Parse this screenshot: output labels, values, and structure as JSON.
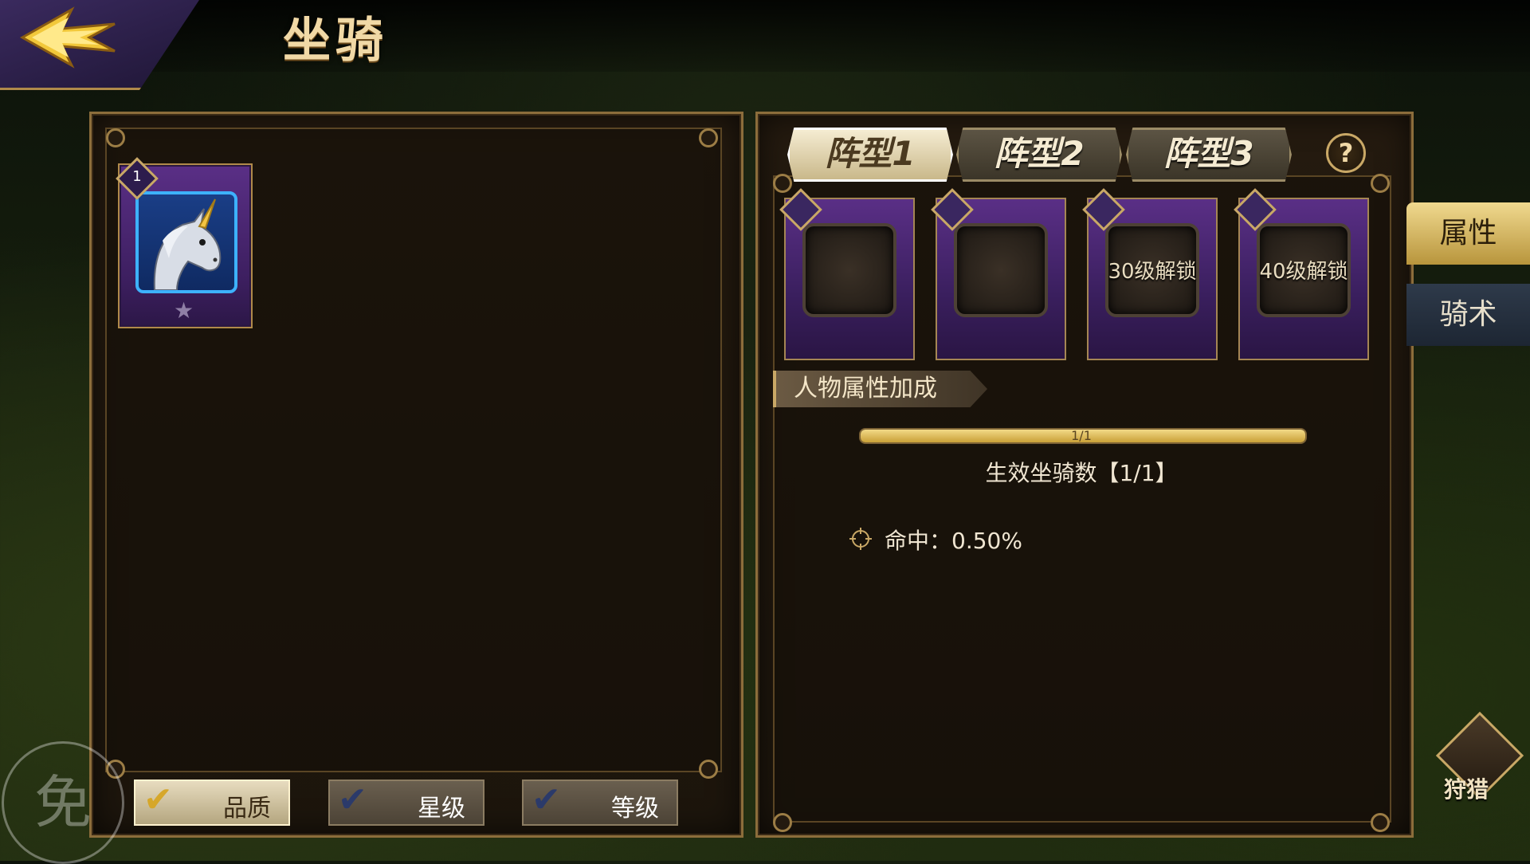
{
  "header": {
    "title": "坐骑",
    "back_icon": "back-arrow-icon"
  },
  "mount_list": {
    "cards": [
      {
        "slot_number": "1",
        "name": "unicorn",
        "star_icon": "star-icon",
        "stars": 1
      }
    ]
  },
  "filters": [
    {
      "label": "品质",
      "checked": true
    },
    {
      "label": "星级",
      "checked": true
    },
    {
      "label": "等级",
      "checked": true
    }
  ],
  "formation_tabs": [
    {
      "label": "阵型1",
      "active": true
    },
    {
      "label": "阵型2",
      "active": false
    },
    {
      "label": "阵型3",
      "active": false
    }
  ],
  "help_label": "?",
  "slots": [
    {
      "lock_text": ""
    },
    {
      "lock_text": ""
    },
    {
      "lock_text": "30级解锁"
    },
    {
      "lock_text": "40级解锁"
    }
  ],
  "bonus": {
    "section_title": "人物属性加成",
    "progress_text": "1/1",
    "progress_fraction": 1.0,
    "effective_text": "生效坐骑数【1/1】",
    "stat_label": "命中：0.50%"
  },
  "side_tabs": [
    {
      "label": "属性",
      "active": true
    },
    {
      "label": "骑术",
      "active": false
    }
  ],
  "hunt": {
    "label": "狩猎"
  },
  "watermark": {
    "text": "免"
  },
  "colors": {
    "accent_gold": "#c9a866",
    "card_purple": "#5a2f86",
    "frame_blue": "#3db2ff"
  }
}
